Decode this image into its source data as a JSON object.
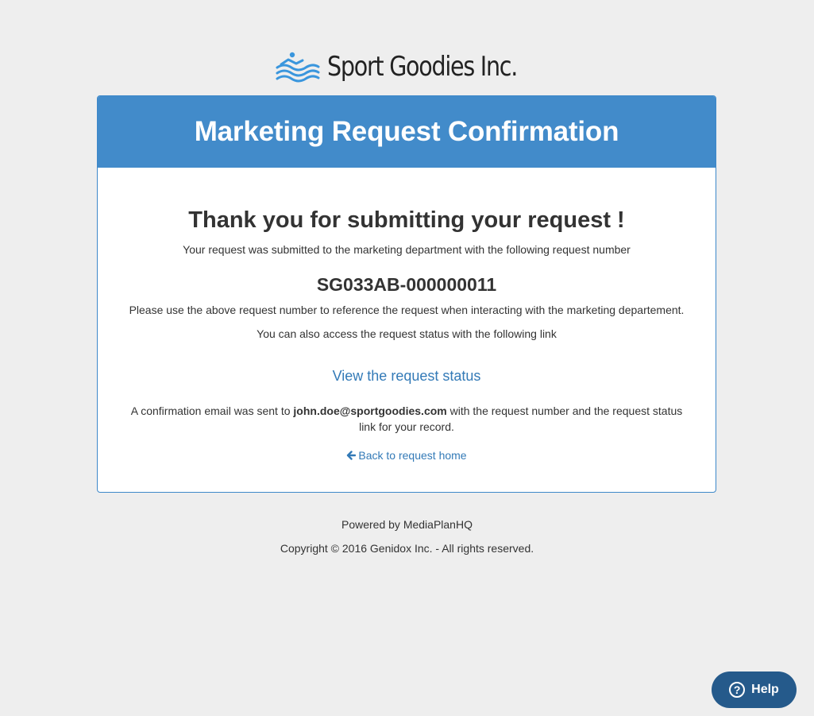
{
  "brand": {
    "name": "Sport Goodies Inc.",
    "logo_icon": "swimmer-waves-icon",
    "logo_color": "#3a96dd"
  },
  "card": {
    "title": "Marketing Request Confirmation",
    "header_color": "#428bca",
    "thank_you": "Thank you for submitting your request !",
    "submitted_text": "Your request was submitted to the marketing department with the following request number",
    "request_number": "SG033AB-000000011",
    "reference_text": "Please use the above request number to reference the request when interacting with the marketing departement.",
    "access_text": "You can also access the request status with the following link",
    "status_link": "View the request status",
    "email_prefix": "A confirmation email was sent to ",
    "email": "john.doe@sportgoodies.com",
    "email_suffix": " with the request number and the request status link for your record.",
    "back_link": "Back to request home",
    "back_icon": "arrow-left-icon",
    "link_color": "#337ab7"
  },
  "footer": {
    "powered_by": "Powered by MediaPlanHQ",
    "copyright": "Copyright © 2016 Genidox Inc. - All rights reserved."
  },
  "help": {
    "label": "Help",
    "icon": "question-circle-icon",
    "color": "#255a8b"
  }
}
